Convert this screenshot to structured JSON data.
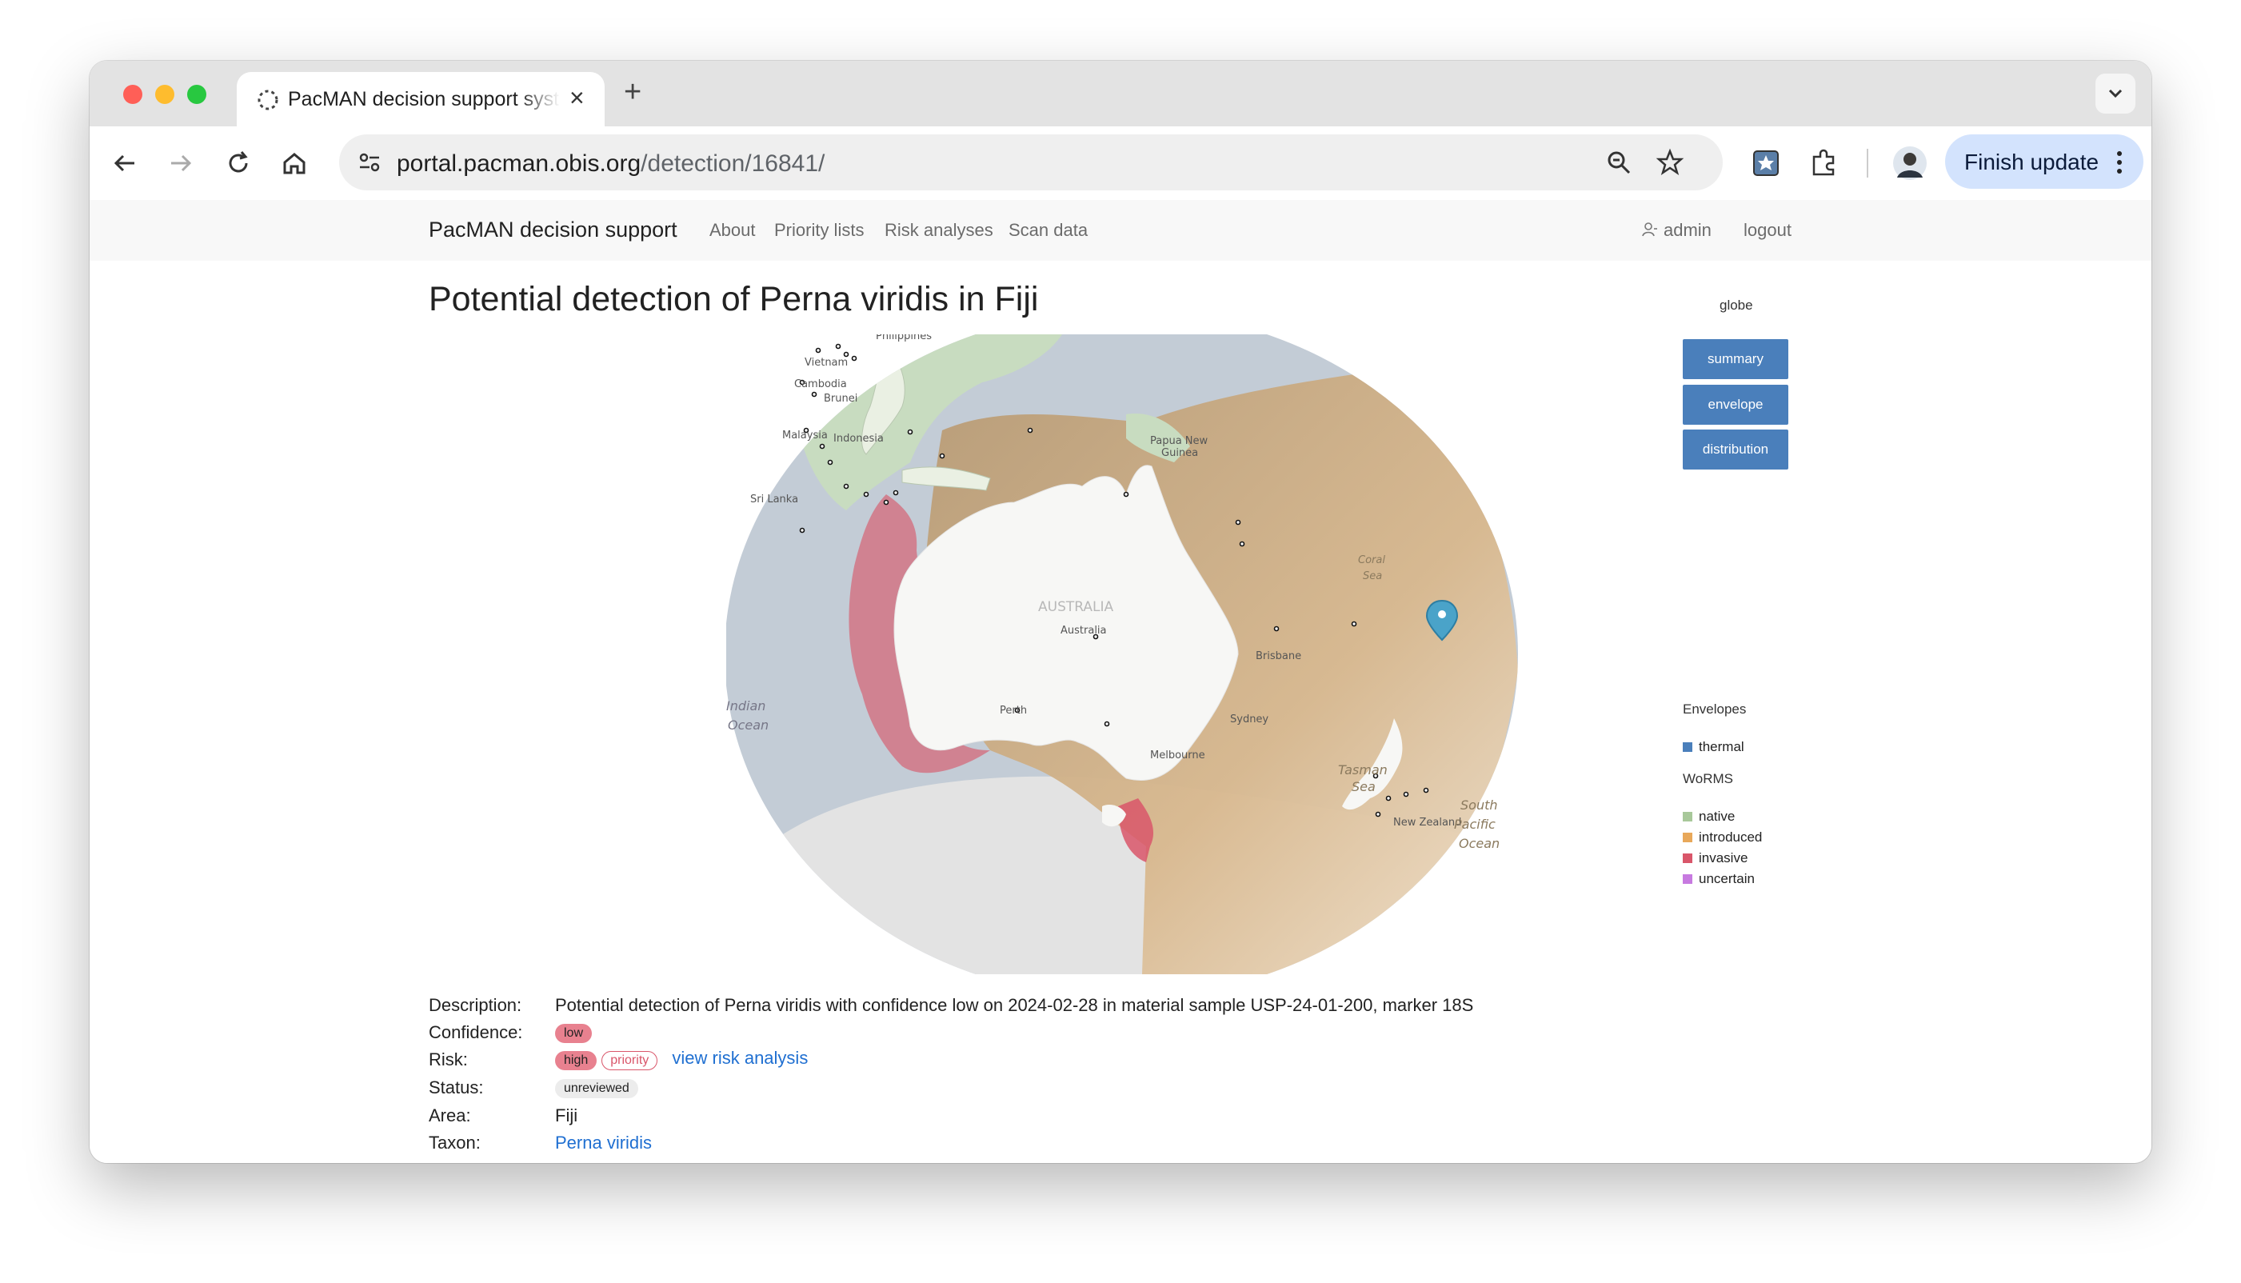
{
  "browser": {
    "tab_title": "PacMAN decision support system",
    "new_tab_symbol": "+",
    "tab_close_symbol": "×",
    "url_host": "portal.pacman.obis.org",
    "url_path": "/detection/16841/",
    "finish_update_label": "Finish update",
    "colors": {
      "tab_bar": "#e3e3e3",
      "finish_bg": "#d3e3fd"
    }
  },
  "nav": {
    "brand": "PacMAN decision support",
    "links": [
      "About",
      "Priority lists",
      "Risk analyses",
      "Scan data"
    ],
    "user": "admin",
    "logout": "logout"
  },
  "page": {
    "title": "Potential detection of Perna viridis in Fiji"
  },
  "map": {
    "place_labels": {
      "philippines": "Philippines",
      "vietnam": "Vietnam",
      "cambodia": "Cambodia",
      "brunei": "Brunei",
      "malaysia": "Malaysia",
      "indonesia": "Indonesia",
      "sri_lanka": "Sri Lanka",
      "papua": "Papua New",
      "guinea": "Guinea",
      "coral_1": "Coral",
      "coral_2": "Sea",
      "australia_region": "AUSTRALIA",
      "australia": "Australia",
      "brisbane": "Brisbane",
      "sydney": "Sydney",
      "melbourne": "Melbourne",
      "perth": "Perth",
      "indian_1": "Indian",
      "indian_2": "Ocean",
      "tasman_1": "Tasman",
      "tasman_2": "Sea",
      "new_zealand": "New Zealand",
      "south_1": "South",
      "south_2": "Pacific",
      "south_3": "Ocean"
    },
    "colors": {
      "ocean": "#c3ccd6",
      "land": "#f7f7f5",
      "native": "#c8dcc0",
      "introduced": "#c9a97a",
      "invasive": "#d17a8a",
      "marker": "#4aa3c9"
    }
  },
  "side": {
    "globe": "globe",
    "buttons": [
      "summary",
      "envelope",
      "distribution"
    ],
    "envelopes_heading": "Envelopes",
    "envelopes": [
      {
        "label": "thermal",
        "color": "#4a7fbb"
      }
    ],
    "worms_heading": "WoRMS",
    "worms": [
      {
        "label": "native",
        "color": "#a8c89a"
      },
      {
        "label": "introduced",
        "color": "#e8a85a"
      },
      {
        "label": "invasive",
        "color": "#d9566a"
      },
      {
        "label": "uncertain",
        "color": "#c77ae0"
      }
    ]
  },
  "details": {
    "description_label": "Description:",
    "description": "Potential detection of Perna viridis with confidence low on 2024-02-28 in material sample USP-24-01-200, marker 18S",
    "confidence_label": "Confidence:",
    "confidence": "low",
    "risk_label": "Risk:",
    "risk": "high",
    "risk_flag": "priority",
    "risk_link": "view risk analysis",
    "status_label": "Status:",
    "status": "unreviewed",
    "area_label": "Area:",
    "area": "Fiji",
    "taxon_label": "Taxon:",
    "taxon": "Perna viridis"
  }
}
